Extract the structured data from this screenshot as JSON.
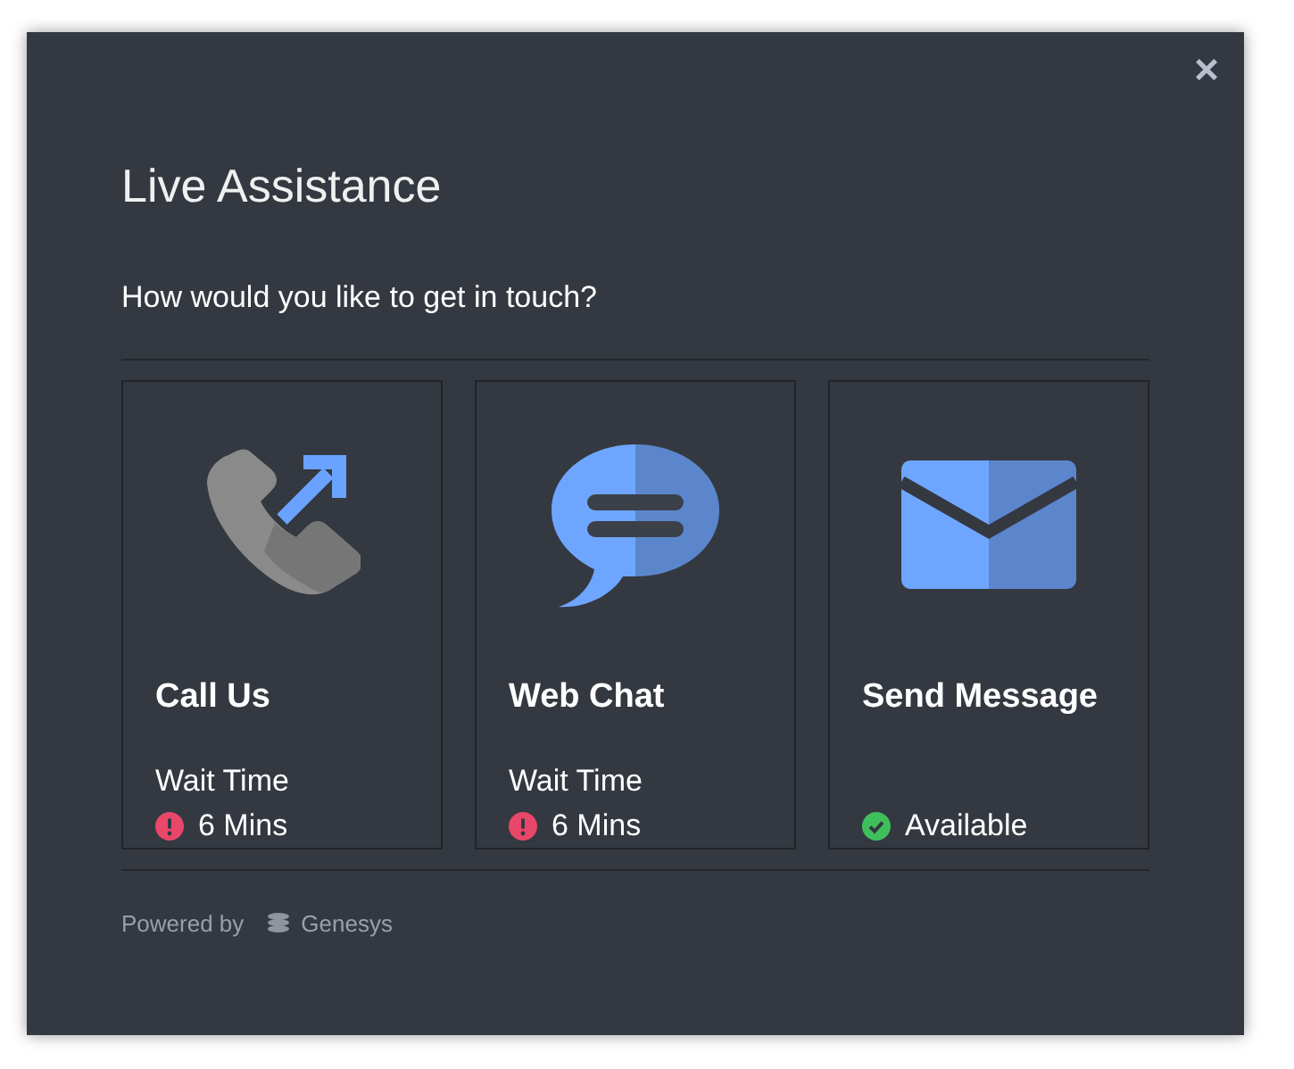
{
  "dialog": {
    "title": "Live Assistance",
    "close": "×"
  },
  "prompt": "How would you like to get in touch?",
  "options": [
    {
      "kind": "phone",
      "title": "Call Us",
      "wait_label": "Wait Time",
      "status": {
        "kind": "wait",
        "text": "6 Mins"
      }
    },
    {
      "kind": "chat",
      "title": "Web Chat",
      "wait_label": "Wait Time",
      "status": {
        "kind": "wait",
        "text": "6 Mins"
      }
    },
    {
      "kind": "message",
      "title": "Send Message",
      "status": {
        "kind": "available",
        "text": "Available"
      }
    }
  ],
  "footer": {
    "powered_by": "Powered by",
    "brand": "Genesys"
  }
}
